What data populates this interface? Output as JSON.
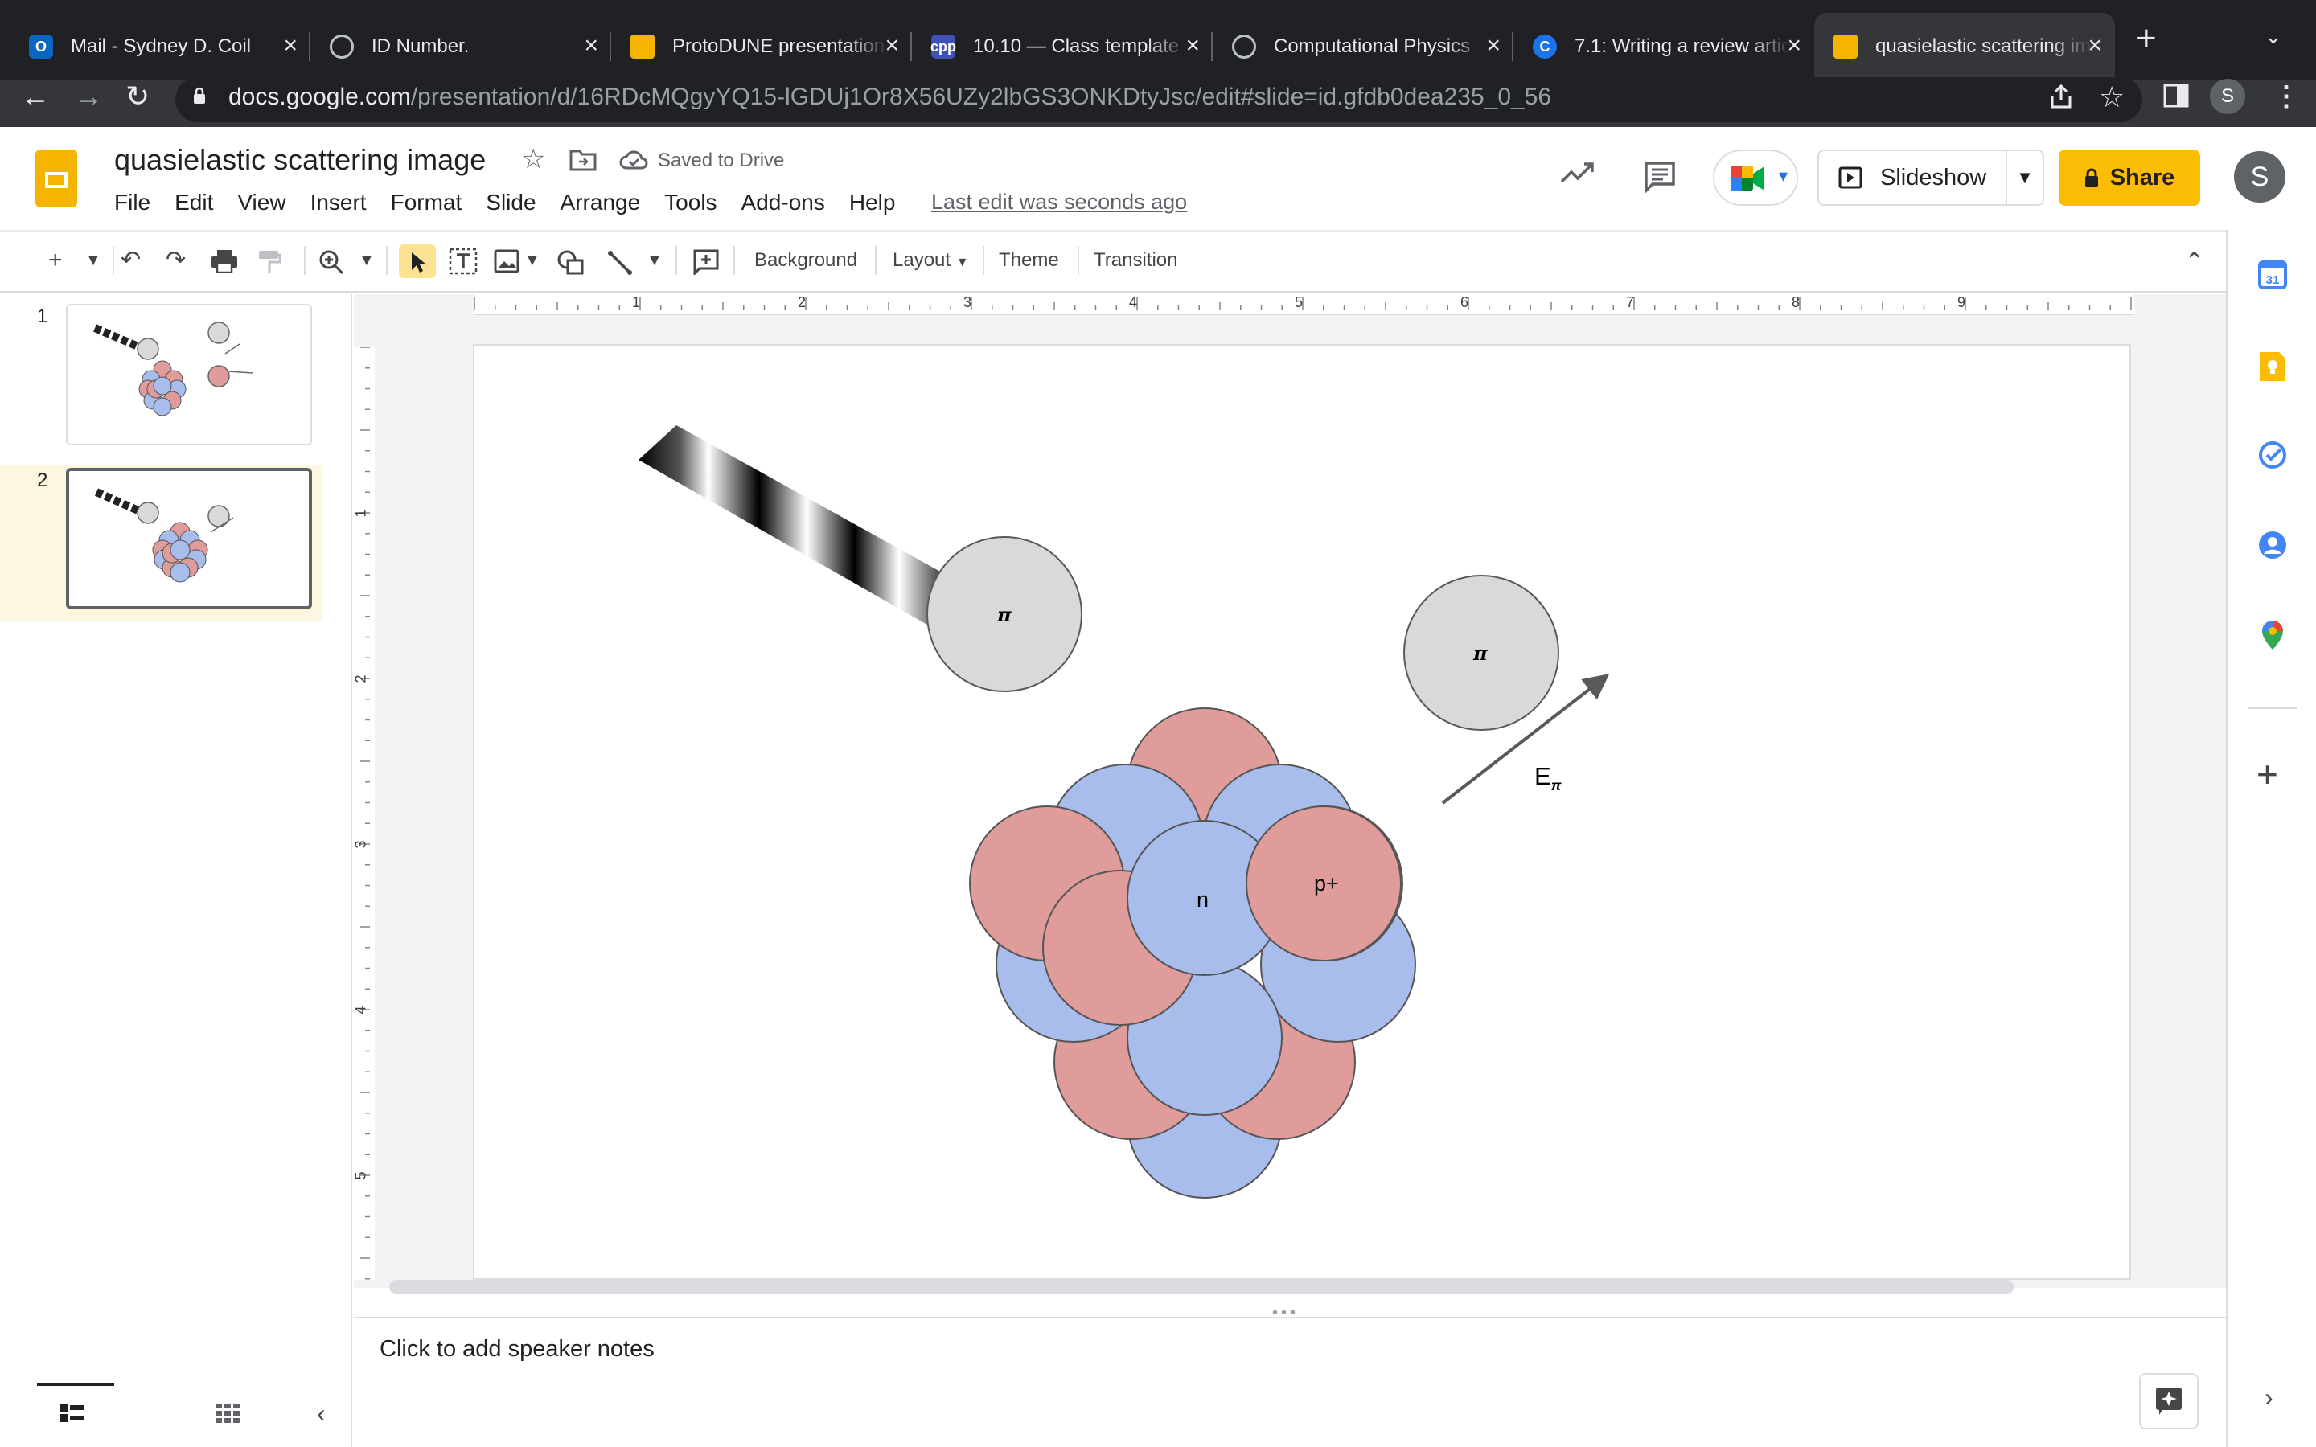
{
  "browser": {
    "tabs": [
      {
        "title": "Mail - Sydney D. Coil",
        "favicon": "outlook-icon",
        "color": "#0a66c2",
        "glyph": "O"
      },
      {
        "title": "ID Number.",
        "favicon": "globe-icon",
        "color": "#9aa0a6",
        "glyph": ""
      },
      {
        "title": "ProtoDUNE presentation",
        "favicon": "slides-icon",
        "color": "#f4b400",
        "glyph": ""
      },
      {
        "title": "10.10 — Class template",
        "favicon": "cpp-icon",
        "color": "#3f51b5",
        "glyph": "cpp"
      },
      {
        "title": "Computational Physics",
        "favicon": "globe-icon",
        "color": "#9aa0a6",
        "glyph": ""
      },
      {
        "title": "7.1: Writing a review article",
        "favicon": "c-icon",
        "color": "#1a73e8",
        "glyph": "C"
      },
      {
        "title": "quasielastic scattering image",
        "favicon": "slides-icon",
        "color": "#f4b400",
        "glyph": ""
      }
    ],
    "url_domain": "docs.google.com",
    "url_path": "/presentation/d/16RDcMQgyYQ15-lGDUj1Or8X56UZy2lbGS3ONKDtyJsc/edit#slide=id.gfdb0dea235_0_56",
    "profile_initial": "S"
  },
  "doc": {
    "title": "quasielastic scattering image",
    "saved_status": "Saved to Drive",
    "last_edit": "Last edit was seconds ago",
    "menus": [
      "File",
      "Edit",
      "View",
      "Insert",
      "Format",
      "Slide",
      "Arrange",
      "Tools",
      "Add-ons",
      "Help"
    ],
    "slideshow_label": "Slideshow",
    "share_label": "Share",
    "user_initial": "S"
  },
  "toolbar": {
    "background": "Background",
    "layout": "Layout",
    "theme": "Theme",
    "transition": "Transition"
  },
  "ruler": {
    "h_labels": [
      "1",
      "2",
      "3",
      "4",
      "5",
      "6",
      "7",
      "8",
      "9"
    ],
    "v_labels": [
      "1",
      "2",
      "3",
      "4",
      "5"
    ]
  },
  "filmstrip": {
    "slides": [
      {
        "number": "1"
      },
      {
        "number": "2"
      }
    ]
  },
  "slide": {
    "pion_label": "π",
    "neutron_label": "n",
    "proton_label": "p+",
    "energy_label": "E",
    "energy_subscript": "π",
    "colors": {
      "proton": "#e09b9b",
      "neutron": "#a8bdec",
      "pion": "#d9d9d9",
      "arrow": "#595959"
    }
  },
  "notes": {
    "placeholder": "Click to add speaker notes"
  }
}
